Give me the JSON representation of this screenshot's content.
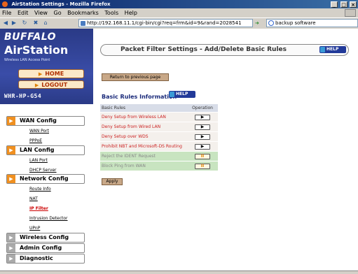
{
  "window": {
    "title": "AirStation Settings - Mozilla Firefox",
    "controls": [
      "_",
      "□",
      "×"
    ]
  },
  "menu": [
    "File",
    "Edit",
    "View",
    "Go",
    "Bookmarks",
    "Tools",
    "Help"
  ],
  "toolbar": {
    "url": "http://192.168.11.1/cgi-bin/cgi?req=frm&id=9&rand=2028541",
    "search": "backup software"
  },
  "sidebar": {
    "brand": "BUFFALO",
    "product": "AirStation",
    "tagline": "Wireless LAN Access Point",
    "home": "HOME",
    "logout": "LOGOUT",
    "model": "WHR-HP-G54",
    "sections": [
      {
        "label": "WAN Config",
        "links": [
          "WAN Port",
          "PPPoE"
        ]
      },
      {
        "label": "LAN Config",
        "links": [
          "LAN Port",
          "DHCP Server"
        ]
      },
      {
        "label": "Network Config",
        "links": [
          "Route Info",
          "NAT",
          "IP Filter",
          "Intrusion Detector",
          "UPnP"
        ]
      },
      {
        "label": "Wireless Config"
      },
      {
        "label": "Admin Config"
      },
      {
        "label": "Diagnostic"
      }
    ]
  },
  "main": {
    "title": "Packet Filter Settings - Add/Delete Basic Rules",
    "help": "HELP",
    "return_label": "Return to previous page",
    "info_heading": "Basic Rules Information",
    "table": {
      "headers": [
        "Basic Rules",
        "Operation"
      ],
      "rows": [
        {
          "rule": "Deny Setup from Wireless LAN",
          "state": "deny",
          "op": "▶"
        },
        {
          "rule": "Deny Setup from Wired LAN",
          "state": "deny",
          "op": "▶"
        },
        {
          "rule": "Deny Setup over WDS",
          "state": "deny",
          "op": "▶"
        },
        {
          "rule": "Prohibit NBT and Microsoft-DS Routing",
          "state": "deny",
          "op": "▶"
        },
        {
          "rule": "Reject the IDENT Request",
          "state": "allow",
          "op": "II"
        },
        {
          "rule": "Block Ping from WAN",
          "state": "allow",
          "op": "II"
        }
      ]
    },
    "apply_label": "Apply"
  }
}
